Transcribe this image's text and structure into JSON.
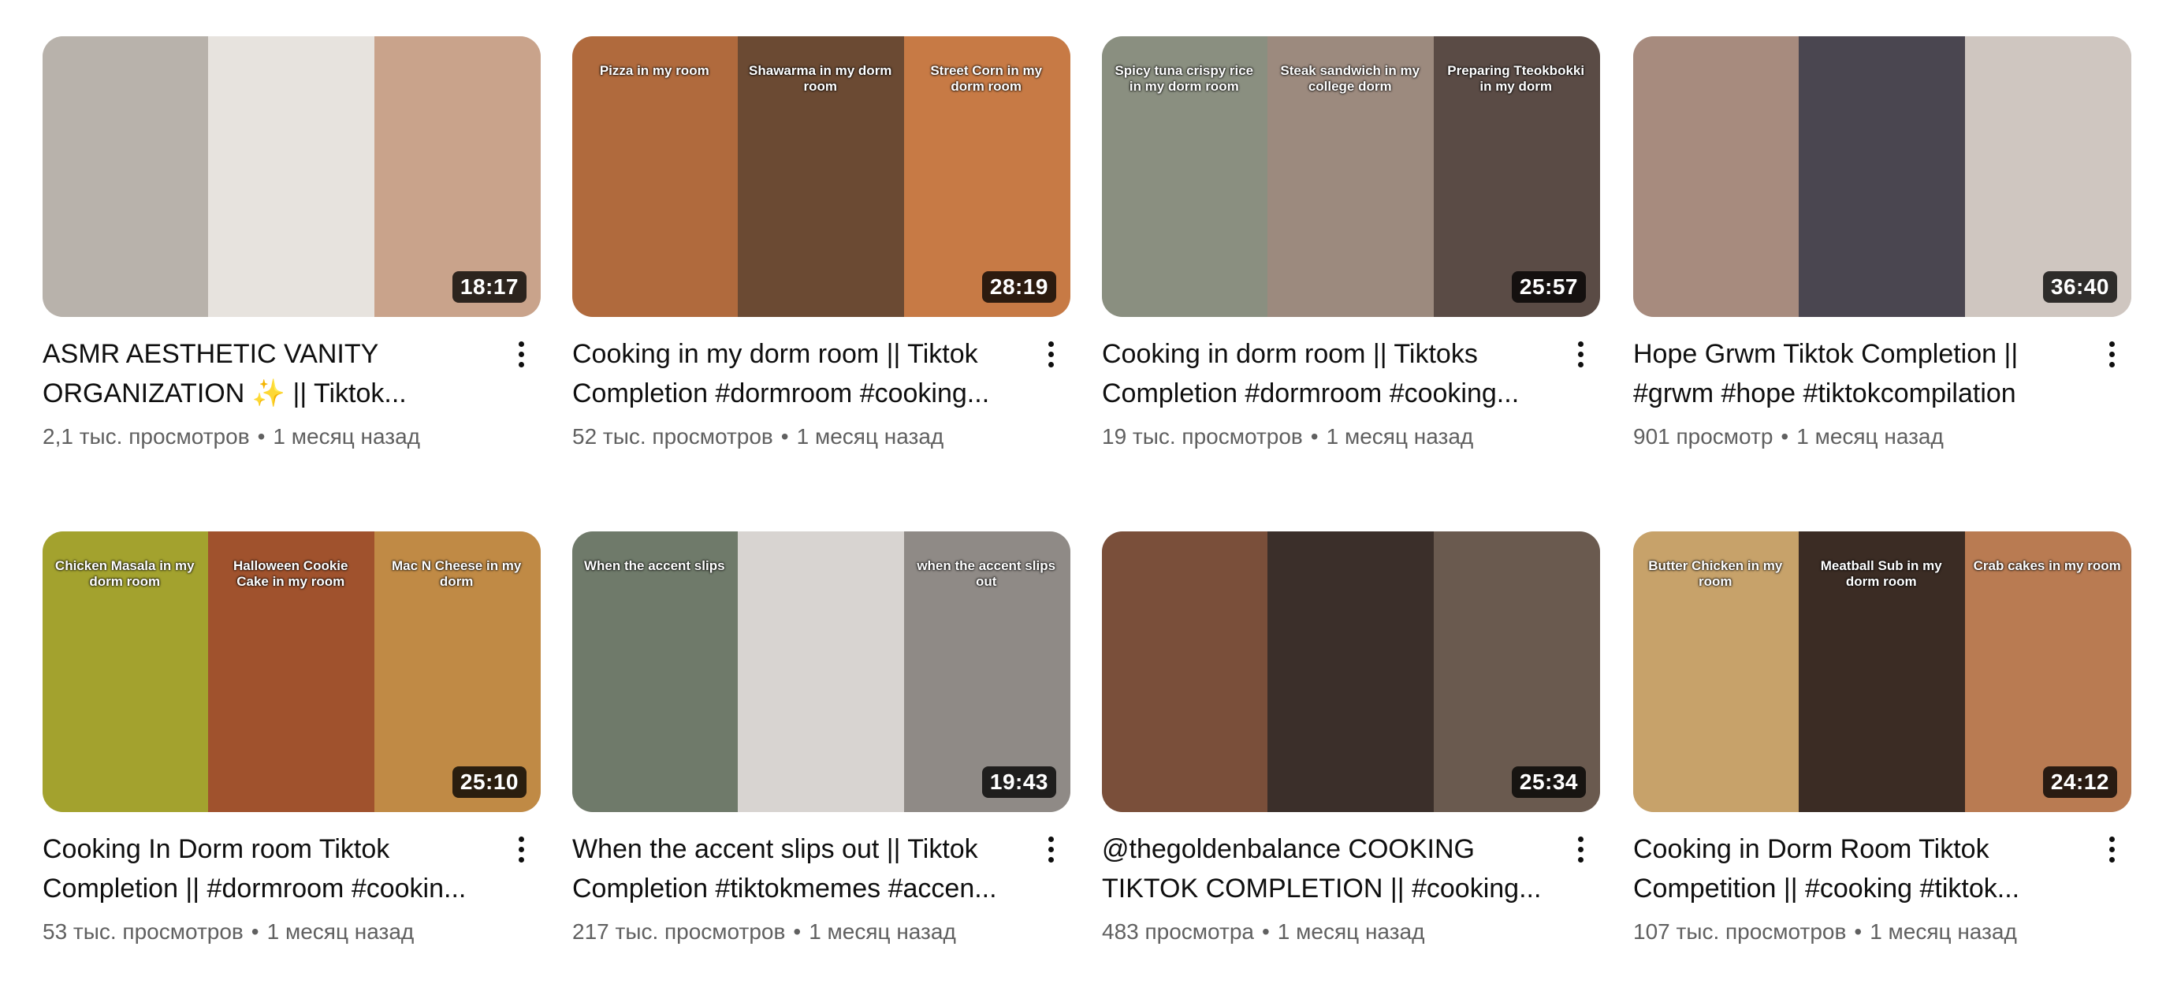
{
  "videos": [
    {
      "title": "ASMR AESTHETIC VANITY\nORGANIZATION ✨ || Tiktok...",
      "views": "2,1 тыс. просмотров",
      "age": "1 месяц назад",
      "duration": "18:17",
      "overlays": [
        "",
        "",
        ""
      ],
      "colors": [
        "#b8b2ab",
        "#e7e3de",
        "#c9a38b"
      ]
    },
    {
      "title": "Cooking in my dorm room || Tiktok\nCompletion #dormroom #cooking...",
      "views": "52 тыс. просмотров",
      "age": "1 месяц назад",
      "duration": "28:19",
      "overlays": [
        "Pizza in my room",
        "Shawarma in my dorm room",
        "Street Corn in my dorm room"
      ],
      "colors": [
        "#b06a3d",
        "#6b4a33",
        "#c77a45"
      ]
    },
    {
      "title": "Cooking in dorm room || Tiktoks\nCompletion #dormroom #cooking...",
      "views": "19 тыс. просмотров",
      "age": "1 месяц назад",
      "duration": "25:57",
      "overlays": [
        "Spicy tuna crispy rice in my dorm room",
        "Steak sandwich in my college dorm",
        "Preparing Tteokbokki in my dorm"
      ],
      "colors": [
        "#8a8f80",
        "#9c8a7e",
        "#5a4b45"
      ]
    },
    {
      "title": "Hope Grwm Tiktok Completion ||\n#grwm #hope #tiktokcompilation",
      "views": "901 просмотр",
      "age": "1 месяц назад",
      "duration": "36:40",
      "overlays": [
        "",
        "",
        ""
      ],
      "colors": [
        "#a78b7e",
        "#4a4650",
        "#cfc6c0"
      ]
    },
    {
      "title": "Cooking In Dorm room Tiktok\nCompletion || #dormroom #cookin...",
      "views": "53 тыс. просмотров",
      "age": "1 месяц назад",
      "duration": "25:10",
      "overlays": [
        "Chicken Masala in my dorm room",
        "Halloween Cookie Cake in my room",
        "Mac N Cheese in my dorm"
      ],
      "colors": [
        "#a3a22e",
        "#a0522d",
        "#c08a45"
      ]
    },
    {
      "title": "When the accent slips out || Tiktok\nCompletion #tiktokmemes #accen...",
      "views": "217 тыс. просмотров",
      "age": "1 месяц назад",
      "duration": "19:43",
      "overlays": [
        "When the accent slips",
        "",
        "when the accent slips out"
      ],
      "colors": [
        "#6f7a6a",
        "#d8d4d1",
        "#8f8a86"
      ]
    },
    {
      "title": "@thegoldenbalance COOKING\nTIKTOK COMPLETION || #cooking...",
      "views": "483 просмотра",
      "age": "1 месяц назад",
      "duration": "25:34",
      "overlays": [
        "",
        "",
        ""
      ],
      "colors": [
        "#7a4f3a",
        "#3b2f2a",
        "#6a5a4f"
      ]
    },
    {
      "title": "Cooking in Dorm Room Tiktok\nCompetition || #cooking #tiktok...",
      "views": "107 тыс. просмотров",
      "age": "1 месяц назад",
      "duration": "24:12",
      "overlays": [
        "Butter Chicken in my room",
        "Meatball Sub in my dorm room",
        "Crab cakes in my room"
      ],
      "colors": [
        "#c7a26a",
        "#3b2c24",
        "#b97b52"
      ]
    }
  ]
}
